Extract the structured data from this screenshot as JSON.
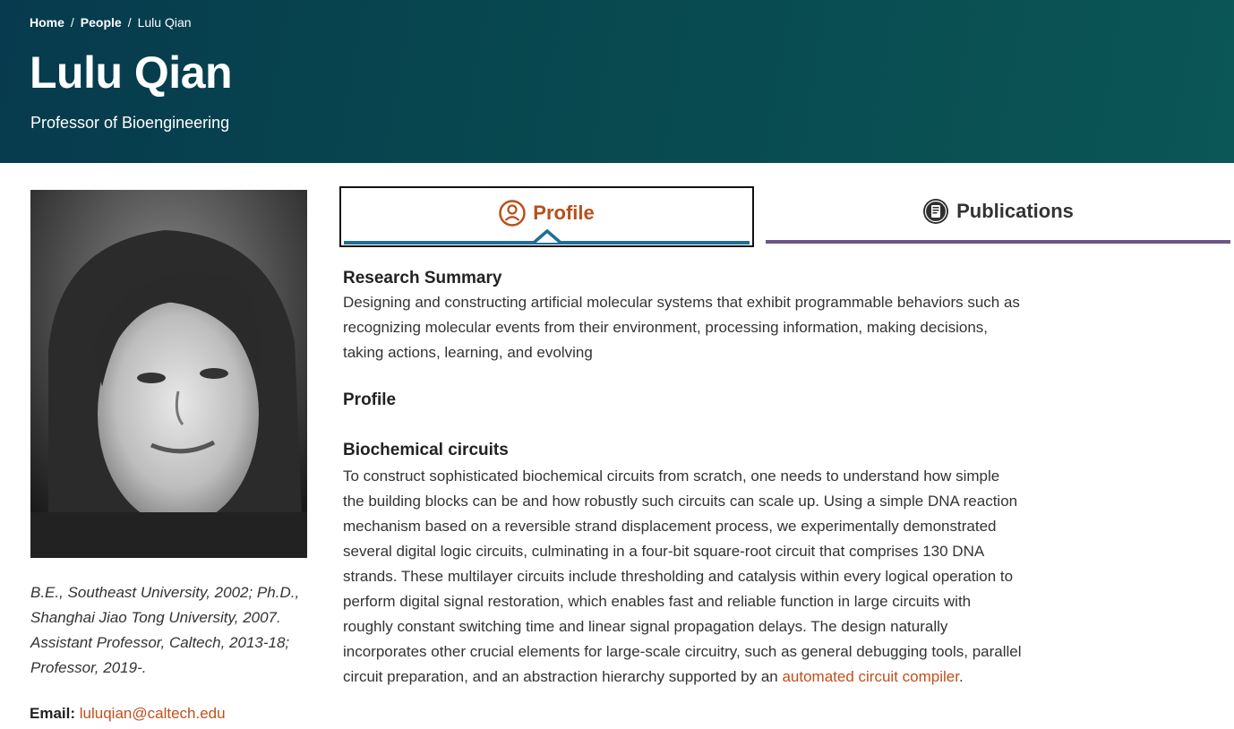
{
  "breadcrumb": {
    "home": "Home",
    "sep1": "/",
    "people": "People",
    "sep2": "/",
    "current": "Lulu Qian"
  },
  "header": {
    "name": "Lulu Qian",
    "position": "Professor of Bioengineering"
  },
  "sidebar": {
    "bio": "B.E., Southeast University, 2002; Ph.D., Shanghai Jiao Tong University, 2007. Assistant Professor, Caltech, 2013-18; Professor, 2019-.",
    "email_label": "Email:",
    "email": "luluqian@caltech.edu"
  },
  "tabs": [
    {
      "label": "Profile",
      "icon": "person-icon",
      "active": true
    },
    {
      "label": "Publications",
      "icon": "book-icon",
      "active": false
    }
  ],
  "content": {
    "research_summary_heading": "Research Summary",
    "research_summary": "Designing and constructing artificial molecular systems that exhibit programmable behaviors such as recognizing molecular events from their environment, processing information, making decisions, taking actions, learning, and evolving",
    "profile_heading": "Profile",
    "biochem_heading": "Biochemical circuits",
    "biochem_text": "To construct sophisticated biochemical circuits from scratch, one needs to understand how simple the building blocks can be and how robustly such circuits can scale up. Using a simple DNA reaction mechanism based on a reversible strand displacement process, we experimentally demonstrated several digital logic circuits, culminating in a four-bit square-root circuit that comprises 130 DNA strands. These multilayer circuits include thresholding and catalysis within every logical operation to perform digital signal restoration, which enables fast and reliable function in large circuits with roughly constant switching time and linear signal propagation delays. The design naturally incorporates other crucial elements for large-scale circuitry, such as general debugging tools, parallel circuit preparation, and an abstraction hierarchy supported by an",
    "biochem_link": "automated circuit compiler",
    "biochem_end": "."
  },
  "colors": {
    "header_start": "#073a4e",
    "header_end": "#0b5656",
    "accent_orange": "#b8501a",
    "link": "#c0501a",
    "tab_active_line": "#1f6e97",
    "tab_inactive_line": "#6b5688"
  }
}
